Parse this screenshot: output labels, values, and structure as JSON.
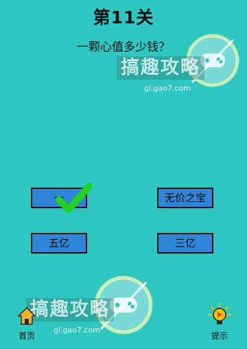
{
  "level": {
    "title": "第11关"
  },
  "question": {
    "text": "一颗心值多少钱？"
  },
  "answers": [
    {
      "label": "一"
    },
    {
      "label": "无价之宝"
    },
    {
      "label": "五亿"
    },
    {
      "label": "三亿"
    }
  ],
  "selected_answer_index": 0,
  "nav": {
    "home_label": "首页",
    "hint_label": "提示"
  },
  "watermark": {
    "text": "搞趣攻略",
    "url": "gl.gao7.com"
  },
  "colors": {
    "background": "#2fc7c2",
    "button": "#2f86d8",
    "check": "#1fd31f",
    "home_icon": "#f0b429",
    "hint_icon": "#f5c000"
  }
}
